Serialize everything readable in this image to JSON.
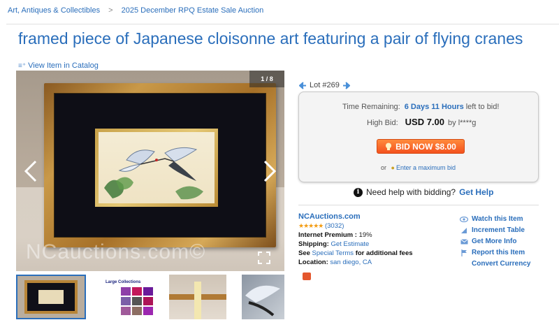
{
  "breadcrumb": {
    "items": [
      "Art, Antiques & Collectibles",
      "2025 December RPQ Estate Sale Auction"
    ],
    "separator": ">"
  },
  "title": "framed piece of Japanese cloisonne art featuring a pair of flying cranes",
  "catalog_link": "View Item in Catalog",
  "gallery": {
    "counter": "1 / 8",
    "watermark": "NCauctions.com©",
    "thumb_2_text": "Large Collections"
  },
  "lot": {
    "label": "Lot #269"
  },
  "bid": {
    "time_label": "Time Remaining:",
    "time_value": "6 Days 11 Hours",
    "time_suffix": "left to bid!",
    "high_label": "High Bid:",
    "high_amount": "USD 7.00",
    "high_by": "by l****g",
    "button": "BID NOW $8.00",
    "or_text": "or",
    "max_link": "Enter a maximum bid"
  },
  "help": {
    "text": "Need help with bidding?",
    "link": "Get Help"
  },
  "seller": {
    "name": "NCAuctions.com",
    "stars": "★★★★★",
    "rating_count": "(3032)",
    "premium_label": "Internet Premium :",
    "premium_value": "19%",
    "shipping_label": "Shipping:",
    "shipping_link": "Get Estimate",
    "terms_pre": "See",
    "terms_link": "Special Terms",
    "terms_post": "for additional fees",
    "location_label": "Location:",
    "location_value": "san diego, CA"
  },
  "actions": {
    "watch": "Watch this Item",
    "increment": "Increment Table",
    "more_info": "Get More Info",
    "report": "Report this Item",
    "convert": "Convert Currency"
  },
  "colors": {
    "link": "#2a6ebb",
    "bid_button": "#f4511e",
    "stars": "#f39c12"
  }
}
